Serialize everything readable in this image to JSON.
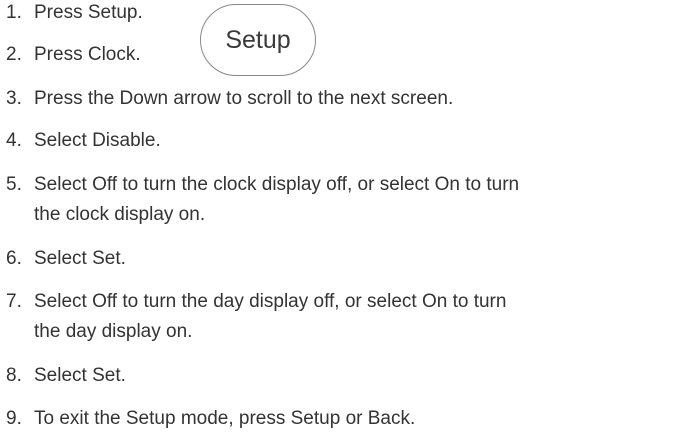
{
  "setup_button": {
    "label": "Setup"
  },
  "steps": [
    {
      "num": "1.",
      "text": "Press Setup."
    },
    {
      "num": "2.",
      "text": "Press Clock."
    },
    {
      "num": "3.",
      "text": "Press the Down arrow to scroll to the next screen."
    },
    {
      "num": "4.",
      "text": "Select Disable."
    },
    {
      "num": "5.",
      "text": "Select Off to turn the clock display off, or select On to turn",
      "continuation": "the clock display on."
    },
    {
      "num": "6.",
      "text": "Select Set."
    },
    {
      "num": "7.",
      "text": "Select Off to turn the day display off, or select On to turn",
      "continuation": "the day display on."
    },
    {
      "num": "8.",
      "text": "Select Set."
    },
    {
      "num": "9.",
      "text": "To exit the Setup mode, press Setup or Back."
    }
  ]
}
